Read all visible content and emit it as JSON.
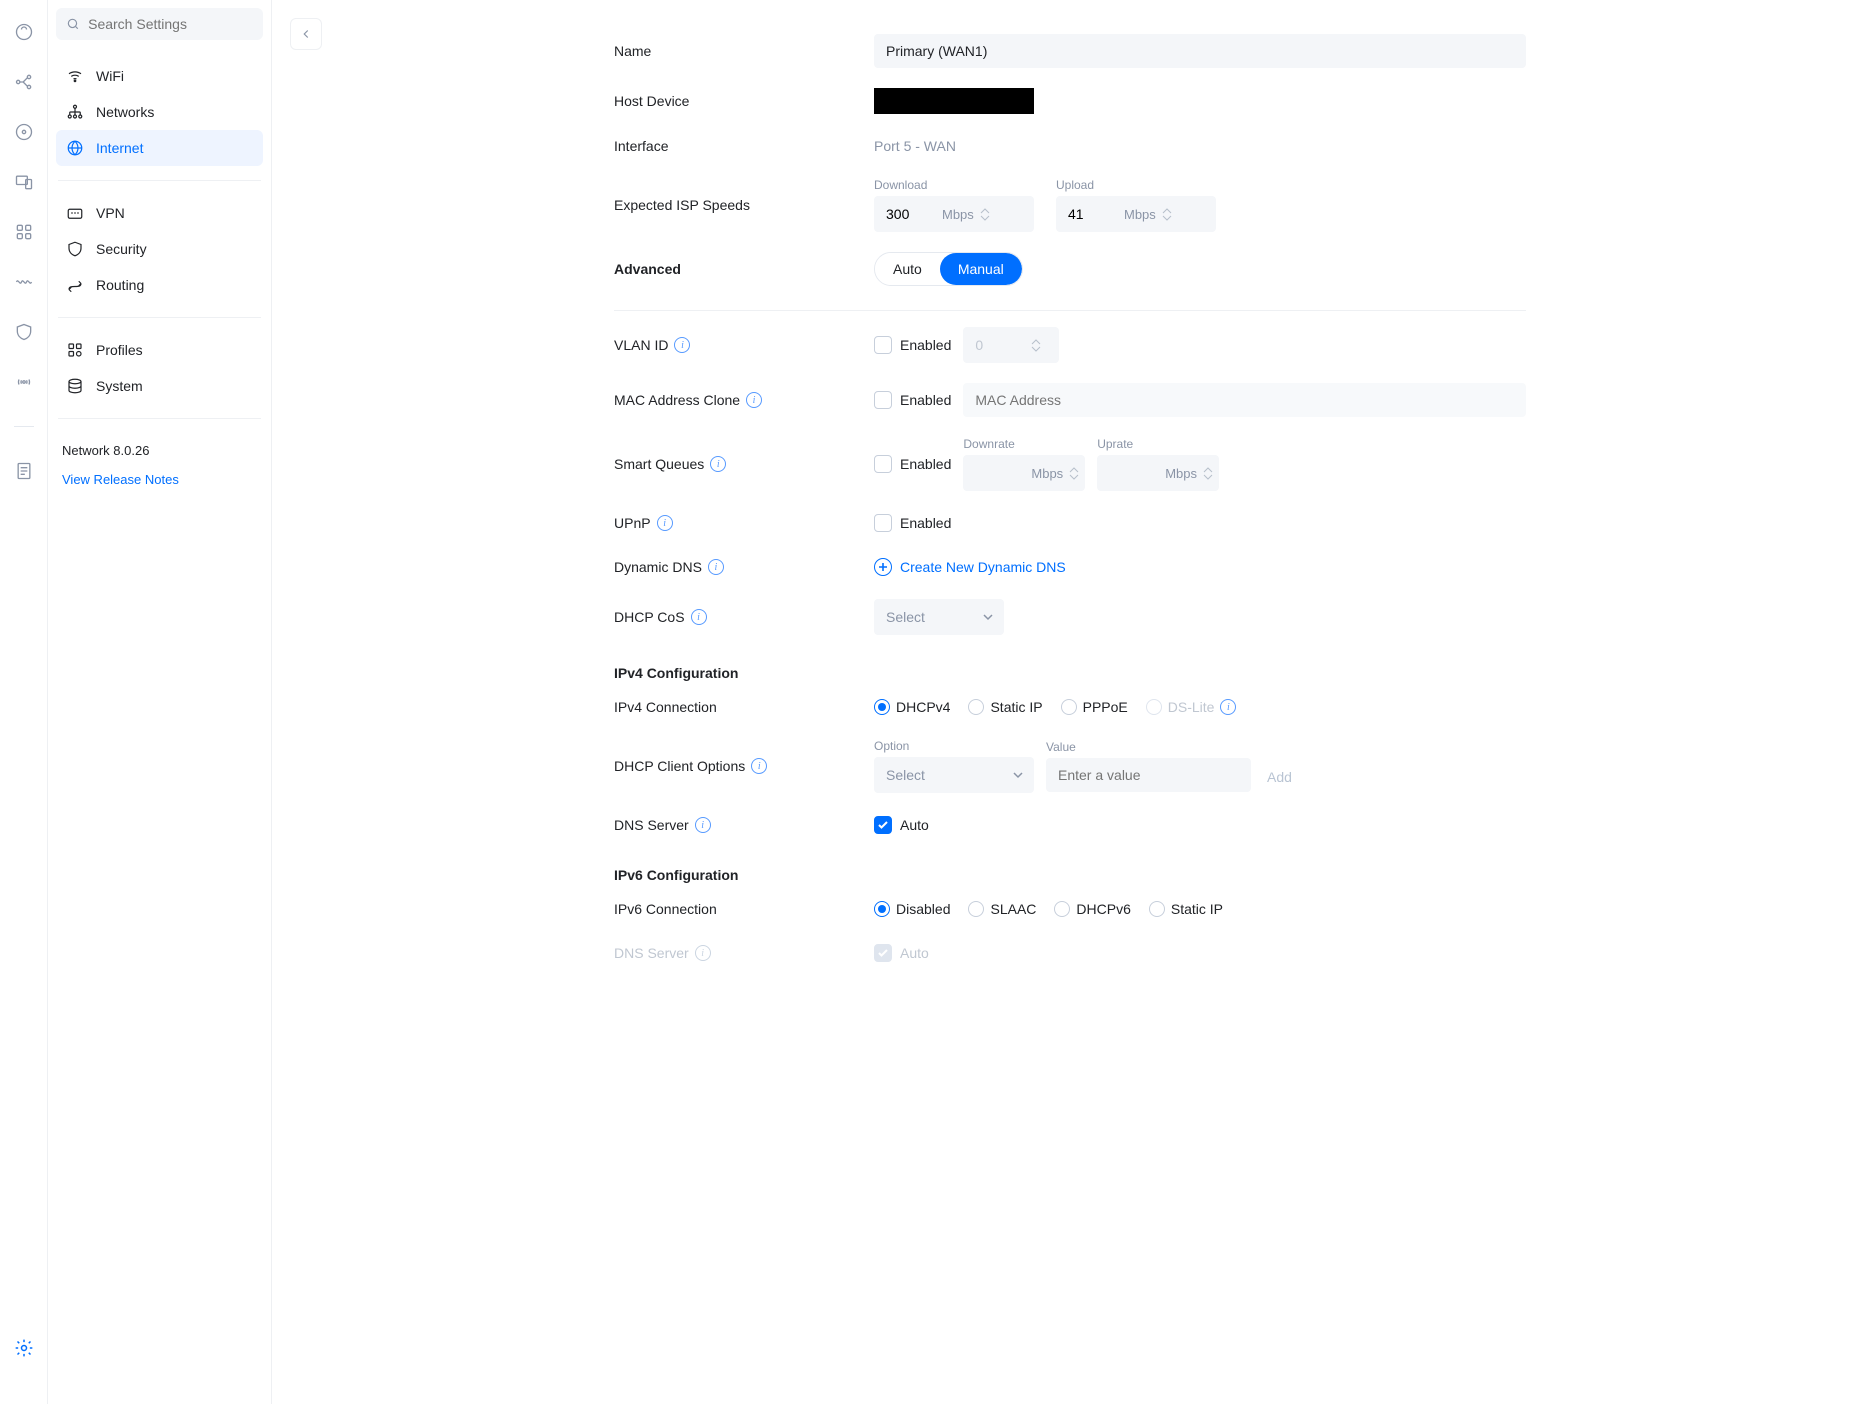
{
  "search": {
    "placeholder": "Search Settings"
  },
  "sidebar": {
    "items": [
      {
        "label": "WiFi"
      },
      {
        "label": "Networks"
      },
      {
        "label": "Internet"
      },
      {
        "label": "VPN"
      },
      {
        "label": "Security"
      },
      {
        "label": "Routing"
      },
      {
        "label": "Profiles"
      },
      {
        "label": "System"
      }
    ],
    "version": "Network 8.0.26",
    "release_notes": "View Release Notes"
  },
  "form": {
    "name_label": "Name",
    "name_value": "Primary (WAN1)",
    "host_label": "Host Device",
    "interface_label": "Interface",
    "interface_value": "Port 5 - WAN",
    "isp_label": "Expected ISP Speeds",
    "download_label": "Download",
    "upload_label": "Upload",
    "download_value": "300",
    "upload_value": "41",
    "unit_mbps": "Mbps",
    "advanced_label": "Advanced",
    "seg_auto": "Auto",
    "seg_manual": "Manual",
    "vlan_label": "VLAN ID",
    "enabled_text": "Enabled",
    "vlan_value": "0",
    "mac_label": "MAC Address Clone",
    "mac_placeholder": "MAC Address",
    "smartq_label": "Smart Queues",
    "downrate_label": "Downrate",
    "uprate_label": "Uprate",
    "upnp_label": "UPnP",
    "ddns_label": "Dynamic DNS",
    "ddns_link": "Create New Dynamic DNS",
    "dhcpcos_label": "DHCP CoS",
    "select_placeholder": "Select",
    "ipv4_section": "IPv4 Configuration",
    "ipv4_conn_label": "IPv4 Connection",
    "ipv4_opts": {
      "dhcp": "DHCPv4",
      "static": "Static IP",
      "pppoe": "PPPoE",
      "dslite": "DS-Lite"
    },
    "dhcp_client_label": "DHCP Client Options",
    "option_label": "Option",
    "value_label": "Value",
    "value_placeholder": "Enter a value",
    "add_label": "Add",
    "dns_label": "DNS Server",
    "auto_text": "Auto",
    "ipv6_section": "IPv6 Configuration",
    "ipv6_conn_label": "IPv6 Connection",
    "ipv6_opts": {
      "disabled": "Disabled",
      "slaac": "SLAAC",
      "dhcp": "DHCPv6",
      "static": "Static IP"
    }
  }
}
